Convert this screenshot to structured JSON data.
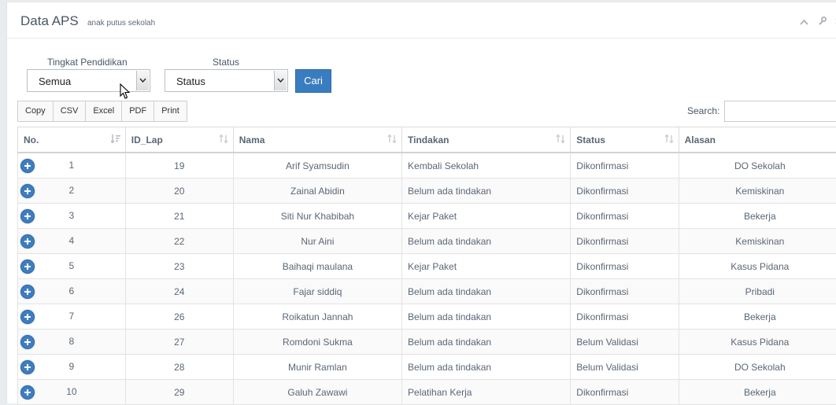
{
  "header": {
    "title": "Data APS",
    "subtitle": "anak putus sekolah"
  },
  "filters": {
    "tingkat_label": "Tingkat Pendidikan",
    "tingkat_value": "Semua",
    "status_label": "Status",
    "status_value": "Status",
    "cari_label": "Cari"
  },
  "export_buttons": [
    "Copy",
    "CSV",
    "Excel",
    "PDF",
    "Print"
  ],
  "search": {
    "label": "Search:"
  },
  "table": {
    "columns": [
      "No.",
      "ID_Lap",
      "Nama",
      "Tindakan",
      "Status",
      "Alasan"
    ],
    "rows": [
      {
        "no": "1",
        "id": "19",
        "nama": "Arif Syamsudin",
        "tindakan": "Kembali Sekolah",
        "status": "Dikonfirmasi",
        "alasan": "DO Sekolah"
      },
      {
        "no": "2",
        "id": "20",
        "nama": "Zainal Abidin",
        "tindakan": "Belum ada tindakan",
        "status": "Dikonfirmasi",
        "alasan": "Kemiskinan"
      },
      {
        "no": "3",
        "id": "21",
        "nama": "Siti Nur Khabibah",
        "tindakan": "Kejar Paket",
        "status": "Dikonfirmasi",
        "alasan": "Bekerja"
      },
      {
        "no": "4",
        "id": "22",
        "nama": "Nur Aini",
        "tindakan": "Belum ada tindakan",
        "status": "Dikonfirmasi",
        "alasan": "Kemiskinan"
      },
      {
        "no": "5",
        "id": "23",
        "nama": "Baihaqi maulana",
        "tindakan": "Kejar Paket",
        "status": "Dikonfirmasi",
        "alasan": "Kasus Pidana"
      },
      {
        "no": "6",
        "id": "24",
        "nama": "Fajar siddiq",
        "tindakan": "Belum ada tindakan",
        "status": "Dikonfirmasi",
        "alasan": "Pribadi"
      },
      {
        "no": "7",
        "id": "26",
        "nama": "Roikatun Jannah",
        "tindakan": "Belum ada tindakan",
        "status": "Dikonfirmasi",
        "alasan": "Bekerja"
      },
      {
        "no": "8",
        "id": "27",
        "nama": "Romdoni Sukma",
        "tindakan": "Belum ada tindakan",
        "status": "Belum Validasi",
        "alasan": "Kasus Pidana"
      },
      {
        "no": "9",
        "id": "28",
        "nama": "Munir Ramlan",
        "tindakan": "Belum ada tindakan",
        "status": "Belum Validasi",
        "alasan": "DO Sekolah"
      },
      {
        "no": "10",
        "id": "29",
        "nama": "Galuh Zawawi",
        "tindakan": "Pelatihan Kerja",
        "status": "Dikonfirmasi",
        "alasan": "Bekerja"
      }
    ]
  }
}
